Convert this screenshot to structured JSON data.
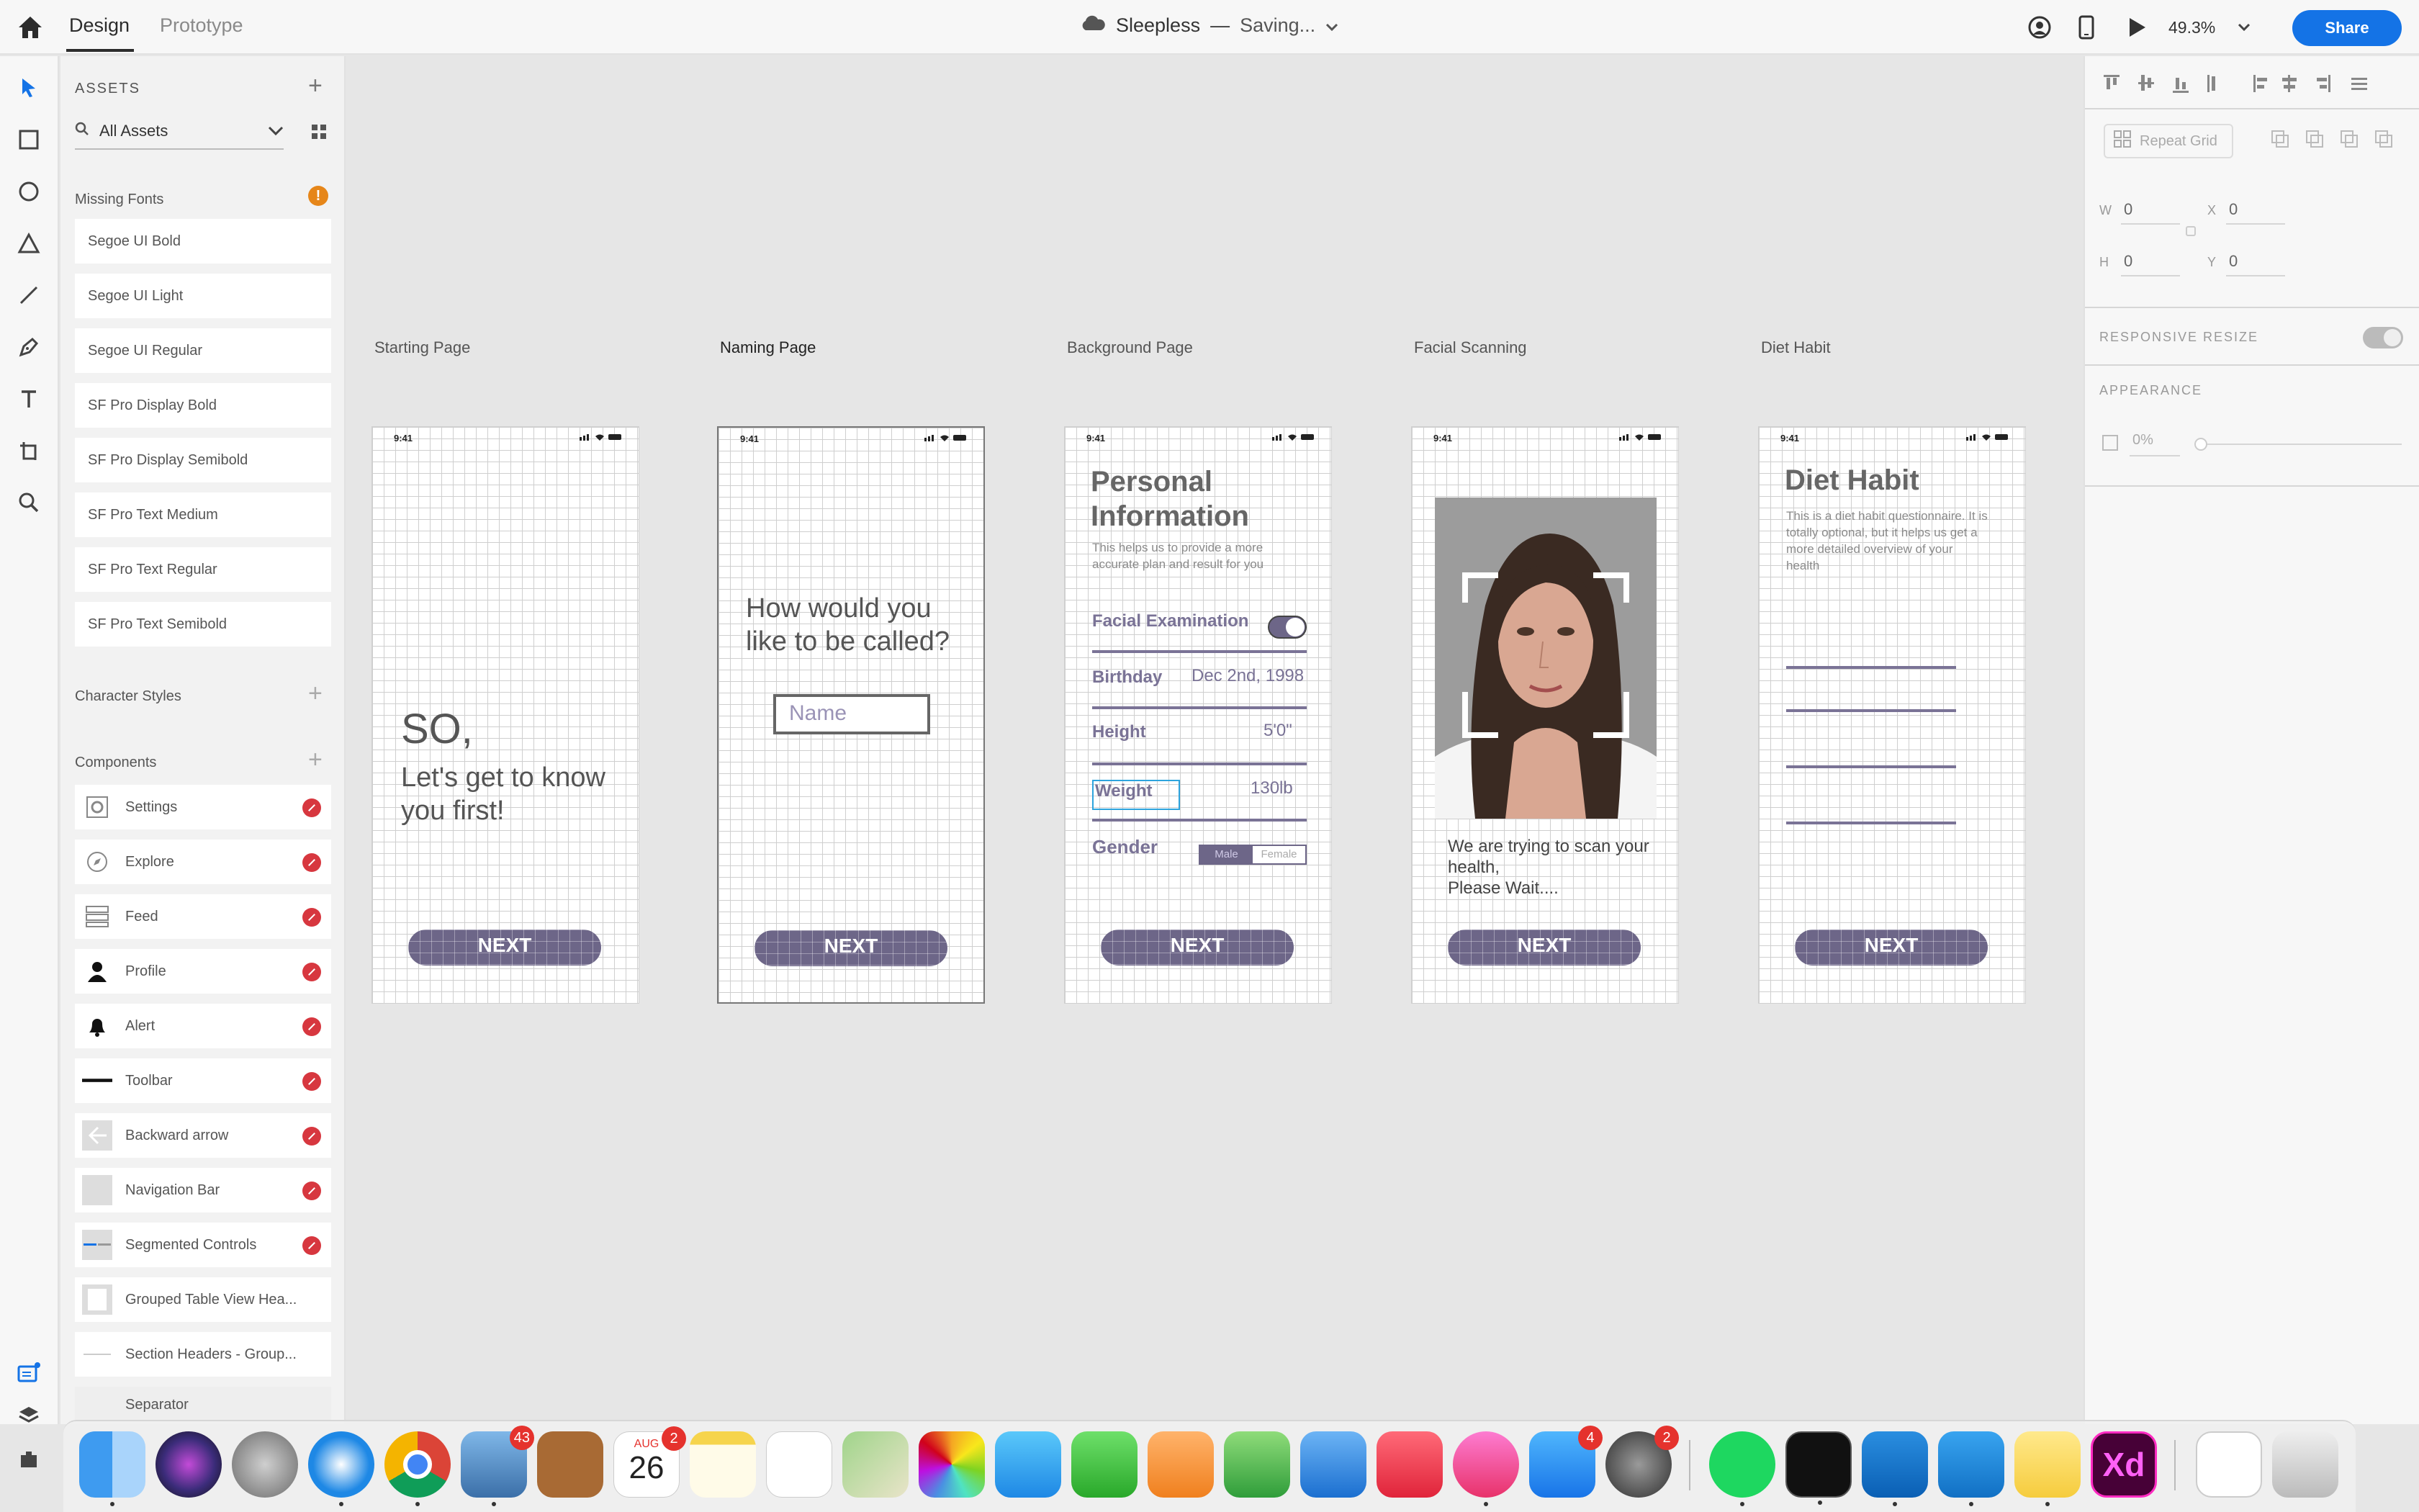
{
  "topbar": {
    "tabs": [
      "Design",
      "Prototype"
    ],
    "doc_name": "Sleepless",
    "doc_sep": "—",
    "doc_status": "Saving...",
    "zoom": "49.3%",
    "share_label": "Share"
  },
  "assets": {
    "title": "ASSETS",
    "filter": "All Assets",
    "missing_fonts_title": "Missing Fonts",
    "fonts": [
      "Segoe UI Bold",
      "Segoe UI Light",
      "Segoe UI Regular",
      "SF Pro Display Bold",
      "SF Pro Display Semibold",
      "SF Pro Text Medium",
      "SF Pro Text Regular",
      "SF Pro Text Semibold"
    ],
    "character_styles_title": "Character Styles",
    "components_title": "Components",
    "components": [
      "Settings",
      "Explore",
      "Feed",
      "Profile",
      "Alert",
      "Toolbar",
      "Backward arrow",
      "Navigation Bar",
      "Segmented Controls",
      "Grouped Table View Hea...",
      "Section Headers - Group...",
      "Separator"
    ]
  },
  "artboards": {
    "labels": [
      "Starting Page",
      "Naming Page",
      "Background Page",
      "Facial Scanning",
      "Diet Habit"
    ],
    "time": "9:41",
    "next_label": "NEXT",
    "starting": {
      "line1": "SO,",
      "line2": "Let's get to know you first!"
    },
    "naming": {
      "question": "How would you like to be called?",
      "placeholder": "Name"
    },
    "background": {
      "title": "Personal Information",
      "subtitle": "This helps us to provide a more accurate plan and result for you",
      "facial": "Facial Examination",
      "birthday_label": "Birthday",
      "birthday_value": "Dec 2nd, 1998",
      "height_label": "Height",
      "height_value": "5'0\"",
      "weight_label": "Weight",
      "weight_value": "130lb",
      "gender_label": "Gender",
      "male": "Male",
      "female": "Female"
    },
    "facial": {
      "message": "We are trying to scan your health,\nPlease Wait...."
    },
    "diet": {
      "title": "Diet Habit",
      "subtitle": "This is a diet habit questionnaire. It is totally optional, but it helps us get a more detailed overview of your health"
    }
  },
  "props": {
    "repeat_grid": "Repeat Grid",
    "w_label": "W",
    "w_value": "0",
    "x_label": "X",
    "x_value": "0",
    "h_label": "H",
    "h_value": "0",
    "y_label": "Y",
    "y_value": "0",
    "responsive_resize": "RESPONSIVE RESIZE",
    "appearance": "APPEARANCE",
    "opacity": "0%"
  },
  "dock": {
    "badges": {
      "mail": "43",
      "calendar": "2",
      "appstore": "4",
      "prefs": "2"
    },
    "calendar_month": "AUG",
    "calendar_day": "26",
    "xd_label": "Xd"
  },
  "colors": {
    "accent": "#1473e6",
    "button": "#6d6688",
    "badge": "#d7373f",
    "warning": "#e68619"
  }
}
